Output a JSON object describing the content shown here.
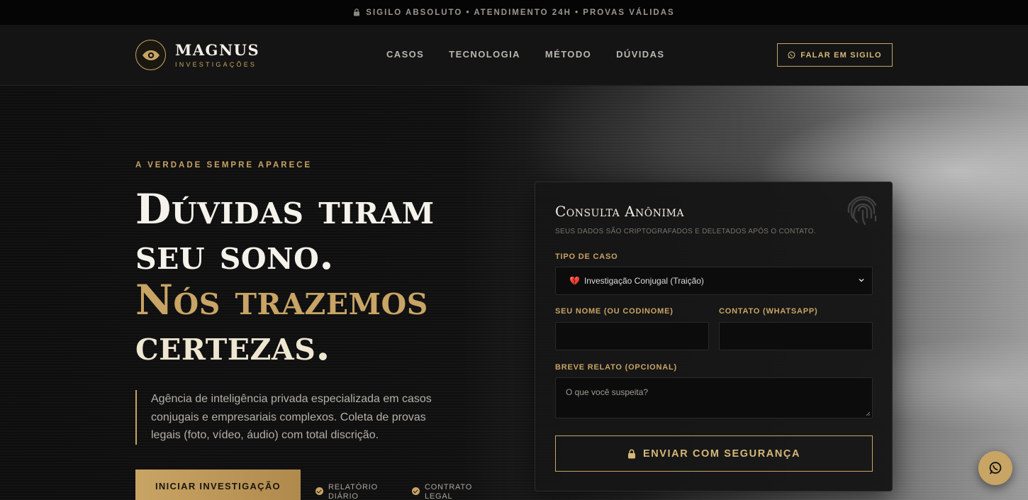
{
  "topbar": {
    "text": "SIGILO ABSOLUTO • ATENDIMENTO 24H • PROVAS VÁLIDAS",
    "icon": "lock-icon"
  },
  "brand": {
    "name": "MAGNUS",
    "subtitle": "INVESTIGAÇÕES",
    "icon": "eye-icon",
    "accent": "#c8a465"
  },
  "nav": {
    "items": [
      {
        "label": "CASOS"
      },
      {
        "label": "TECNOLOGIA"
      },
      {
        "label": "MÉTODO"
      },
      {
        "label": "DÚVIDAS"
      }
    ],
    "cta": "FALAR EM SIGILO"
  },
  "hero": {
    "kicker": "A VERDADE SEMPRE APARECE",
    "headline": {
      "line1": "Dúvidas tiram",
      "line2": "seu sono.",
      "line3": "Nós trazemos",
      "line4": "certezas."
    },
    "lead": "Agência de inteligência privada especializada em casos conjugais e empresariais complexos. Coleta de provas legais (foto, vídeo, áudio) com total discrição.",
    "primary_button": "INICIAR INVESTIGAÇÃO",
    "badges": [
      {
        "label": "RELATÓRIO DIÁRIO"
      },
      {
        "label": "CONTRATO LEGAL"
      }
    ]
  },
  "form": {
    "title": "Consulta Anônima",
    "subtitle": "SEUS DADOS SÃO CRIPTOGRAFADOS E DELETADOS APÓS O CONTATO.",
    "case_type_label": "TIPO DE CASO",
    "case_type_value": "Investigação Conjugal (Traição)",
    "case_type_emoji": "💔",
    "name_label": "SEU NOME (OU CODINOME)",
    "name_value": "",
    "contact_label": "CONTATO (WHATSAPP)",
    "contact_value": "",
    "report_label": "BREVE RELATO (OPCIONAL)",
    "report_placeholder": "O que você suspeita?",
    "submit": "ENVIAR COM SEGURANÇA"
  },
  "floating": {
    "icon": "whatsapp-icon"
  }
}
